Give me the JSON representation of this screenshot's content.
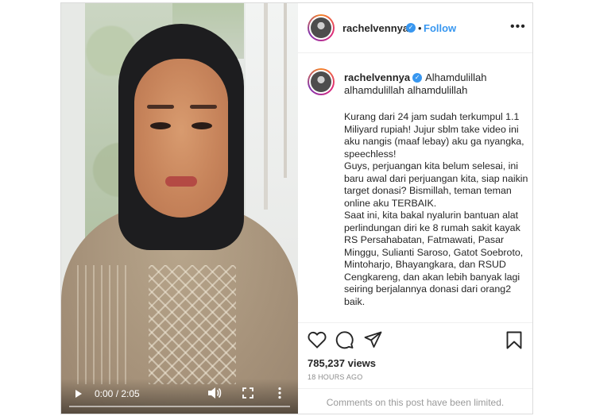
{
  "video": {
    "time": "0:00 / 2:05",
    "progress": 0
  },
  "header": {
    "username": "rachelvennya",
    "verified_icon": "verified-badge",
    "separator": "•",
    "follow_label": "Follow",
    "more_icon": "more-horizontal"
  },
  "caption": {
    "username": "rachelvennya",
    "lead": "Alhamdulillah alhamdulillah alhamdulillah",
    "paragraph1": "Kurang dari 24 jam sudah terkumpul 1.1 Miliyard rupiah! Jujur sblm take video ini aku nangis (maaf lebay) aku ga nyangka, speechless!",
    "paragraph2": "Guys, perjuangan kita belum selesai, ini baru awal dari perjuangan kita, siap naikin target donasi? Bismillah, teman teman online aku TERBAIK.",
    "paragraph3": "Saat ini, kita bakal nyalurin bantuan alat perlindungan diri ke 8 rumah sakit kayak RS Persahabatan, Fatmawati, Pasar Minggu, Sulianti Saroso, Gatot Soebroto, Mintoharjo, Bhayangkara, dan RSUD Cengkareng, dan akan lebih banyak lagi seiring berjalannya donasi dari orang2 baik."
  },
  "stats": {
    "views": "785,237 views",
    "time_ago": "18 HOURS AGO"
  },
  "comments": {
    "limited_text": "Comments on this post have been limited."
  },
  "colors": {
    "accent": "#3897f0",
    "text": "#262626",
    "muted": "#8e8e8e",
    "border": "#dbdbdb"
  }
}
